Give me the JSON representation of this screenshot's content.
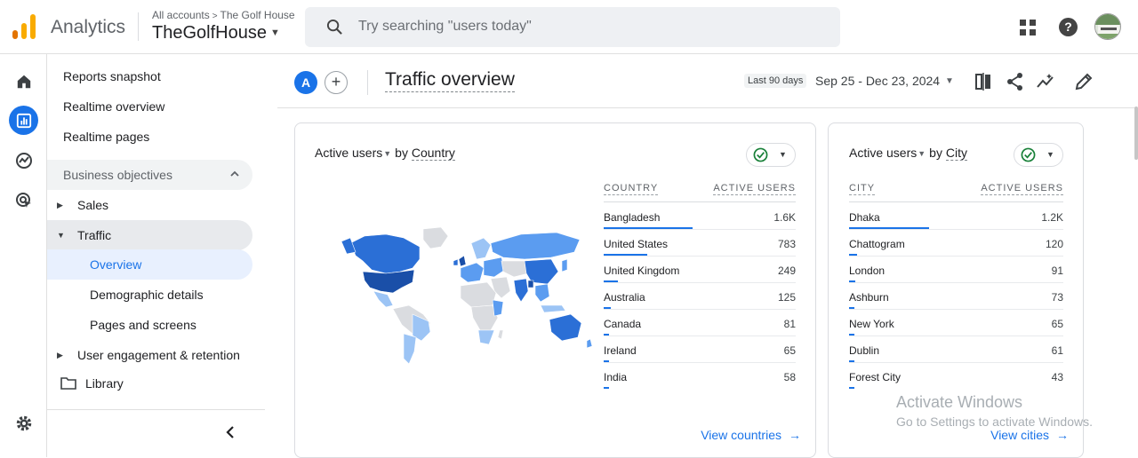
{
  "app": {
    "name": "Analytics",
    "brand_colors": [
      "#F9AB00",
      "#E37400"
    ]
  },
  "header": {
    "breadcrumb_root": "All accounts",
    "breadcrumb_current": "The Golf House",
    "account_name": "TheGolfHouse",
    "search_placeholder": "Try searching \"users today\""
  },
  "rail": {
    "items": [
      {
        "icon": "home-icon"
      },
      {
        "icon": "reports-icon",
        "active": true
      },
      {
        "icon": "explore-icon"
      },
      {
        "icon": "advertising-icon"
      },
      {
        "icon": "settings-icon"
      }
    ]
  },
  "sidebar": {
    "top_items": [
      "Reports snapshot",
      "Realtime overview",
      "Realtime pages"
    ],
    "group_label": "Business objectives",
    "sales": "Sales",
    "traffic": "Traffic",
    "traffic_children": [
      "Overview",
      "Demographic details",
      "Pages and screens"
    ],
    "user_engagement": "User engagement & retention",
    "library": "Library"
  },
  "toolbar": {
    "segment_letter": "A",
    "add_symbol": "+",
    "page_title": "Traffic overview",
    "date_preset": "Last 90 days",
    "date_range": "Sep 25 - Dec 23, 2024"
  },
  "country_card": {
    "metric": "Active users",
    "by": "by",
    "dimension": "Country",
    "col_dim": "COUNTRY",
    "col_metric": "ACTIVE USERS",
    "rows": [
      {
        "label": "Bangladesh",
        "value": "1.6K",
        "share": 1.0
      },
      {
        "label": "United States",
        "value": "783",
        "share": 0.49
      },
      {
        "label": "United Kingdom",
        "value": "249",
        "share": 0.16
      },
      {
        "label": "Australia",
        "value": "125",
        "share": 0.08
      },
      {
        "label": "Canada",
        "value": "81",
        "share": 0.05
      },
      {
        "label": "Ireland",
        "value": "65",
        "share": 0.04
      },
      {
        "label": "India",
        "value": "58",
        "share": 0.04
      }
    ],
    "link": "View countries",
    "map_colors": {
      "high": "#1a4fa8",
      "mid": "#2b6fd6",
      "low": "#5b9cf0",
      "lowest": "#9cc4f5",
      "none": "#dadce0"
    }
  },
  "city_card": {
    "metric": "Active users",
    "by": "by",
    "dimension": "City",
    "col_dim": "CITY",
    "col_metric": "ACTIVE USERS",
    "rows": [
      {
        "label": "Dhaka",
        "value": "1.2K",
        "share": 1.0
      },
      {
        "label": "Chattogram",
        "value": "120",
        "share": 0.1
      },
      {
        "label": "London",
        "value": "91",
        "share": 0.08
      },
      {
        "label": "Ashburn",
        "value": "73",
        "share": 0.06
      },
      {
        "label": "New York",
        "value": "65",
        "share": 0.05
      },
      {
        "label": "Dublin",
        "value": "61",
        "share": 0.05
      },
      {
        "label": "Forest City",
        "value": "43",
        "share": 0.04
      }
    ],
    "link": "View cities"
  },
  "watermark": {
    "title": "Activate Windows",
    "subtitle": "Go to Settings to activate Windows."
  }
}
